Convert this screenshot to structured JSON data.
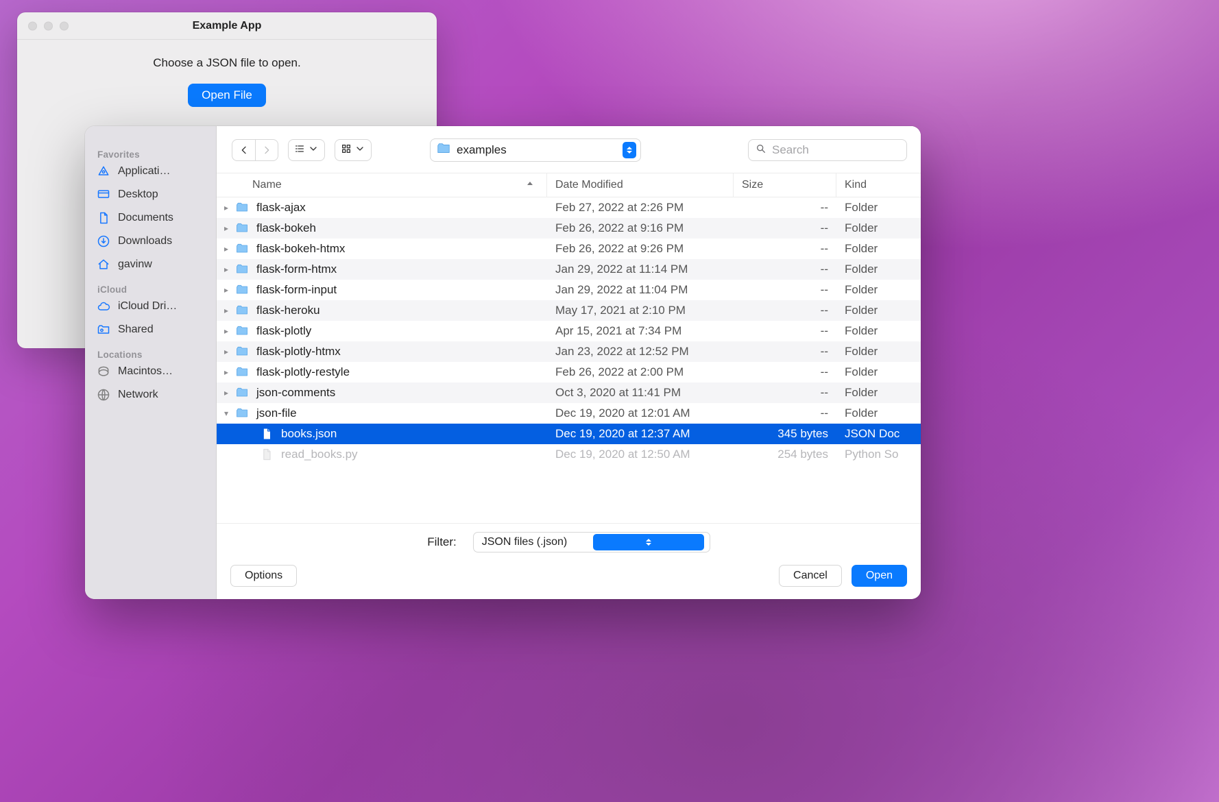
{
  "app_window": {
    "title": "Example App",
    "prompt": "Choose a JSON file to open.",
    "open_button": "Open File"
  },
  "dialog": {
    "sidebar": {
      "sections": {
        "favorites": "Favorites",
        "icloud": "iCloud",
        "locations": "Locations"
      },
      "items": {
        "applications": "Applicati…",
        "desktop": "Desktop",
        "documents": "Documents",
        "downloads": "Downloads",
        "home": "gavinw",
        "icloud_drive": "iCloud Dri…",
        "shared": "Shared",
        "macintosh": "Macintos…",
        "network": "Network"
      }
    },
    "toolbar": {
      "location": "examples",
      "search_placeholder": "Search"
    },
    "columns": {
      "name": "Name",
      "date": "Date Modified",
      "size": "Size",
      "kind": "Kind"
    },
    "rows": [
      {
        "expand": "closed",
        "depth": 0,
        "icon": "folder",
        "name": "flask-ajax",
        "date": "Feb 27, 2022 at 2:26 PM",
        "size": "--",
        "kind": "Folder",
        "style": ""
      },
      {
        "expand": "closed",
        "depth": 0,
        "icon": "folder",
        "name": "flask-bokeh",
        "date": "Feb 26, 2022 at 9:16 PM",
        "size": "--",
        "kind": "Folder",
        "style": "alt"
      },
      {
        "expand": "closed",
        "depth": 0,
        "icon": "folder",
        "name": "flask-bokeh-htmx",
        "date": "Feb 26, 2022 at 9:26 PM",
        "size": "--",
        "kind": "Folder",
        "style": ""
      },
      {
        "expand": "closed",
        "depth": 0,
        "icon": "folder",
        "name": "flask-form-htmx",
        "date": "Jan 29, 2022 at 11:14 PM",
        "size": "--",
        "kind": "Folder",
        "style": "alt"
      },
      {
        "expand": "closed",
        "depth": 0,
        "icon": "folder",
        "name": "flask-form-input",
        "date": "Jan 29, 2022 at 11:04 PM",
        "size": "--",
        "kind": "Folder",
        "style": ""
      },
      {
        "expand": "closed",
        "depth": 0,
        "icon": "folder",
        "name": "flask-heroku",
        "date": "May 17, 2021 at 2:10 PM",
        "size": "--",
        "kind": "Folder",
        "style": "alt"
      },
      {
        "expand": "closed",
        "depth": 0,
        "icon": "folder",
        "name": "flask-plotly",
        "date": "Apr 15, 2021 at 7:34 PM",
        "size": "--",
        "kind": "Folder",
        "style": ""
      },
      {
        "expand": "closed",
        "depth": 0,
        "icon": "folder",
        "name": "flask-plotly-htmx",
        "date": "Jan 23, 2022 at 12:52 PM",
        "size": "--",
        "kind": "Folder",
        "style": "alt"
      },
      {
        "expand": "closed",
        "depth": 0,
        "icon": "folder",
        "name": "flask-plotly-restyle",
        "date": "Feb 26, 2022 at 2:00 PM",
        "size": "--",
        "kind": "Folder",
        "style": ""
      },
      {
        "expand": "closed",
        "depth": 0,
        "icon": "folder",
        "name": "json-comments",
        "date": "Oct 3, 2020 at 11:41 PM",
        "size": "--",
        "kind": "Folder",
        "style": "alt"
      },
      {
        "expand": "open",
        "depth": 0,
        "icon": "folder",
        "name": "json-file",
        "date": "Dec 19, 2020 at 12:01 AM",
        "size": "--",
        "kind": "Folder",
        "style": ""
      },
      {
        "expand": "none",
        "depth": 1,
        "icon": "doc",
        "name": "books.json",
        "date": "Dec 19, 2020 at 12:37 AM",
        "size": "345 bytes",
        "kind": "JSON Doc",
        "style": "sel"
      },
      {
        "expand": "none",
        "depth": 1,
        "icon": "doc-dim",
        "name": "read_books.py",
        "date": "Dec 19, 2020 at 12:50 AM",
        "size": "254 bytes",
        "kind": "Python So",
        "style": "dim"
      }
    ],
    "filter": {
      "label": "Filter:",
      "value": "JSON files (.json)"
    },
    "buttons": {
      "options": "Options",
      "cancel": "Cancel",
      "open": "Open"
    }
  }
}
